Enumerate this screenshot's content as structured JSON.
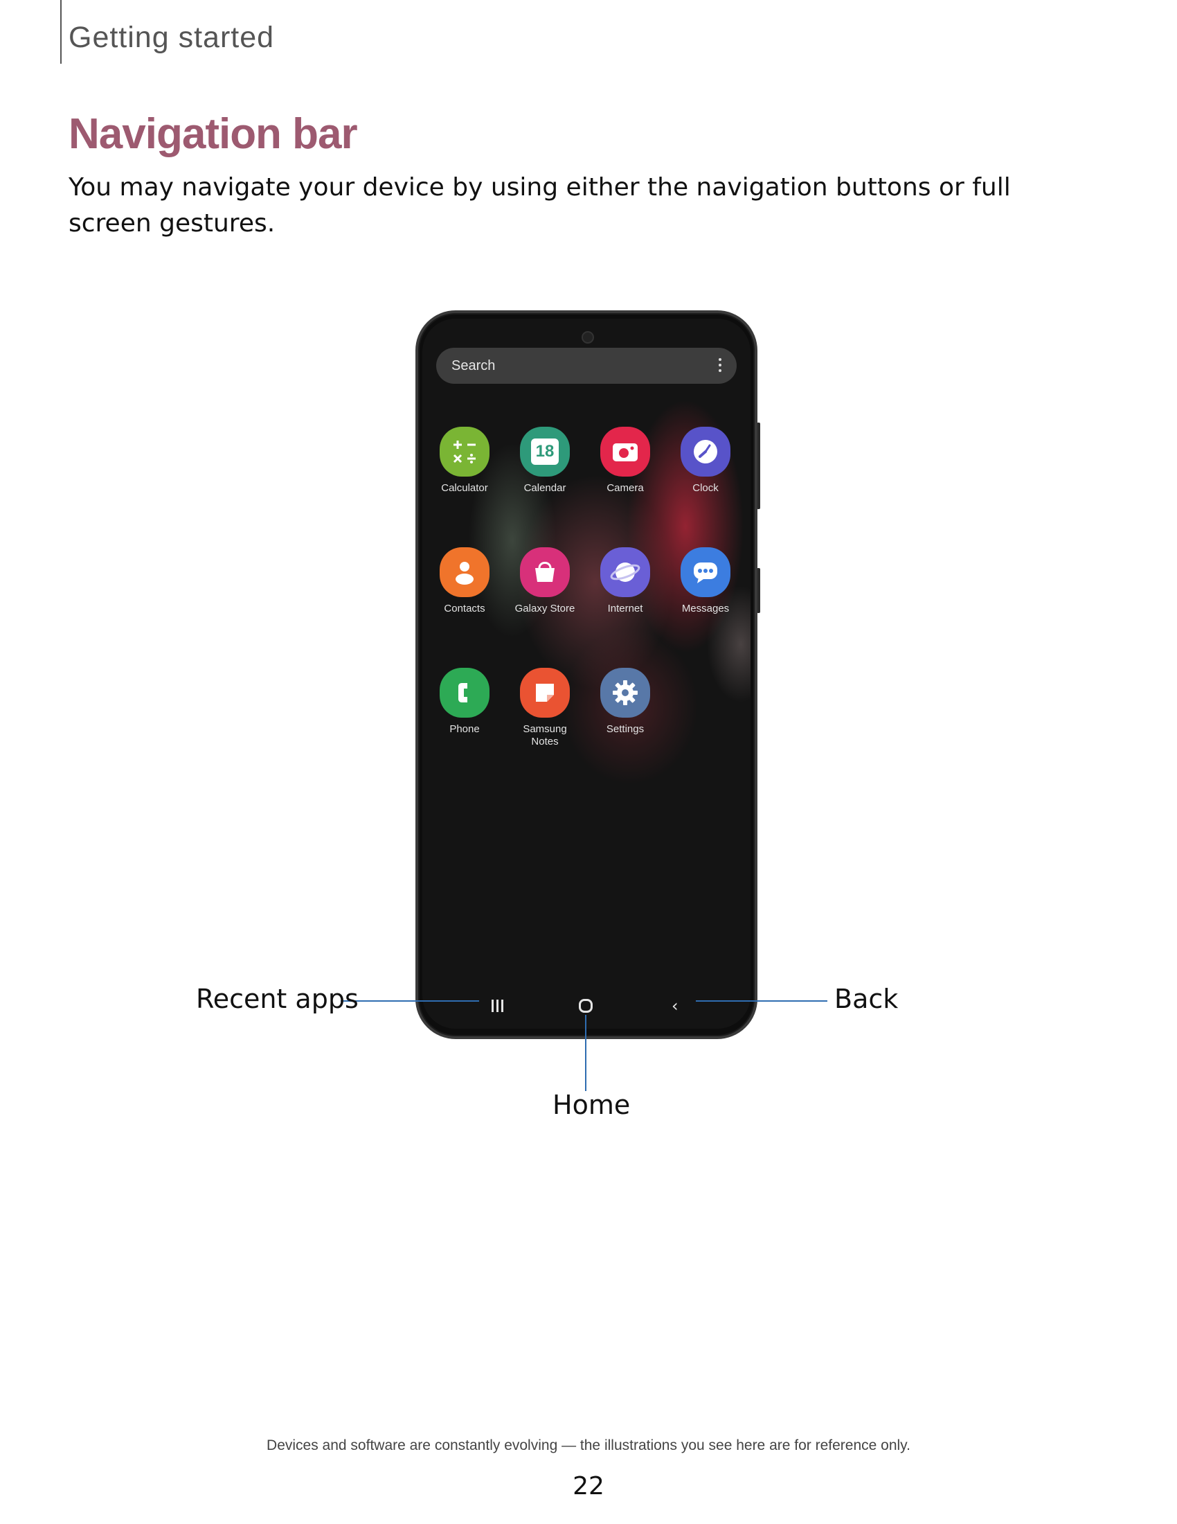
{
  "header": {
    "section_title": "Getting started"
  },
  "page": {
    "heading": "Navigation bar",
    "intro": "You may navigate your device by using either the navigation buttons or full screen gestures."
  },
  "phone": {
    "search": {
      "label": "Search",
      "icon": "more-vertical-icon"
    },
    "apps": [
      {
        "label": "Calculator",
        "icon": "calculator-icon",
        "color": "#7ab534"
      },
      {
        "label": "Calendar",
        "icon": "calendar-icon",
        "color": "#2e9a7a",
        "glyph": "18"
      },
      {
        "label": "Camera",
        "icon": "camera-icon",
        "color": "#e3264b"
      },
      {
        "label": "Clock",
        "icon": "clock-icon",
        "color": "#5853c9"
      },
      {
        "label": "Contacts",
        "icon": "contacts-icon",
        "color": "#f0742b"
      },
      {
        "label": "Galaxy Store",
        "icon": "galaxy-store-icon",
        "color": "#d8307a"
      },
      {
        "label": "Internet",
        "icon": "internet-icon",
        "color": "#6a5fd6"
      },
      {
        "label": "Messages",
        "icon": "messages-icon",
        "color": "#3c7de0"
      },
      {
        "label": "Phone",
        "icon": "phone-icon",
        "color": "#2daa55"
      },
      {
        "label": "Samsung Notes",
        "icon": "samsung-notes-icon",
        "color": "#ea5332"
      },
      {
        "label": "Settings",
        "icon": "settings-icon",
        "color": "#5878a8"
      }
    ],
    "nav_buttons": [
      "recent-apps-icon",
      "home-icon",
      "back-icon"
    ]
  },
  "callouts": {
    "recent_apps": "Recent apps",
    "home": "Home",
    "back": "Back"
  },
  "footer": {
    "note": "Devices and software are constantly evolving — the illustrations you see here are for reference only.",
    "page_number": "22"
  }
}
